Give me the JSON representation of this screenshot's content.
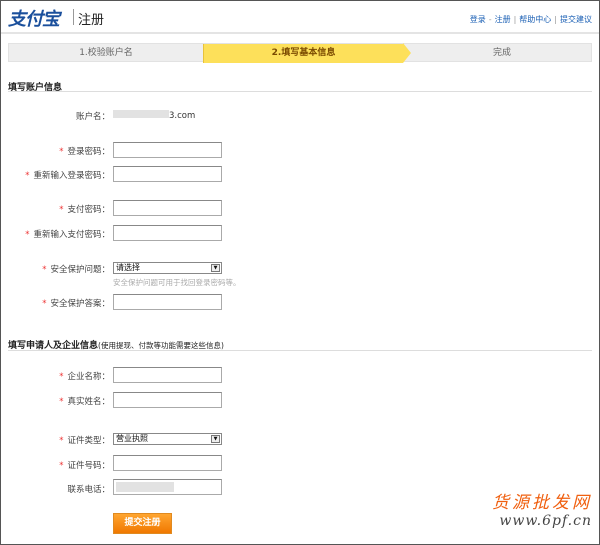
{
  "header": {
    "logo": "支付宝",
    "title": "注册",
    "links": [
      "登录",
      "注册",
      "帮助中心",
      "提交建议"
    ]
  },
  "steps": [
    {
      "label": "1.校验账户名",
      "active": false
    },
    {
      "label": "2.填写基本信息",
      "active": true
    },
    {
      "label": "完成",
      "active": false
    }
  ],
  "account_section": {
    "title": "填写账户信息",
    "account_name_label": "账户名：",
    "account_name_suffix": "3.com",
    "login_password": "登录密码：",
    "login_password_confirm": "重新输入登录密码：",
    "pay_password": "支付密码：",
    "pay_password_confirm": "重新输入支付密码：",
    "security_question": "安全保护问题：",
    "security_question_value": "请选择",
    "security_hint": "安全保护问题可用于找回登录密码等。",
    "security_answer": "安全保护答案："
  },
  "company_section": {
    "title": "填写申请人及企业信息",
    "subtitle": "(使用提现、付款等功能需要这些信息)",
    "company_name": "企业名称：",
    "real_name": "真实姓名：",
    "id_type": "证件类型：",
    "id_type_value": "营业执照",
    "id_number": "证件号码：",
    "phone": "联系电话："
  },
  "submit_label": "提交注册",
  "required_mark": "*",
  "watermark": {
    "line1": "货源批发网",
    "line2": "www.6pf.cn"
  },
  "colors": {
    "accent": "#fde05a",
    "button": "#f08a10",
    "link": "#1a5fb4",
    "required": "#e33333"
  }
}
